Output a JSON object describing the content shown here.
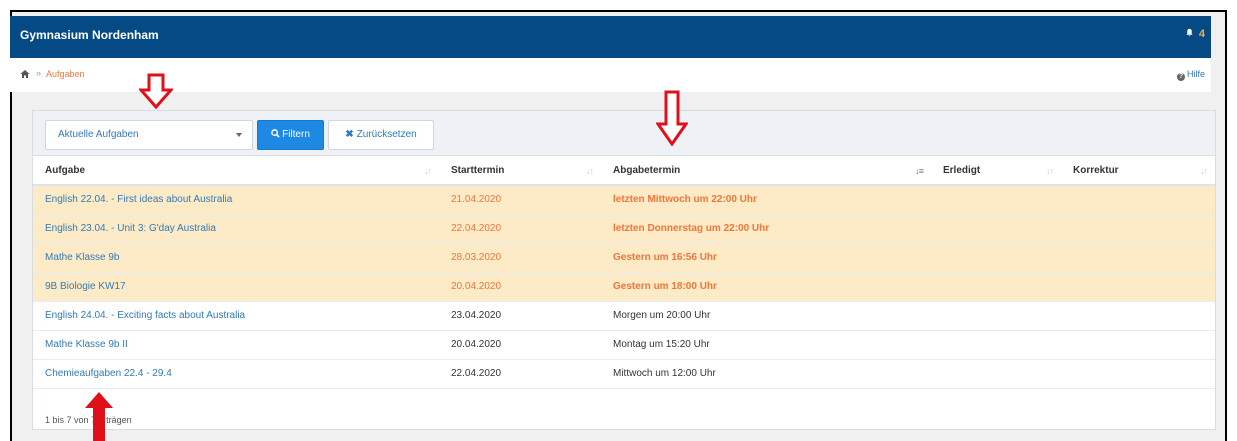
{
  "header": {
    "brand": "Gymnasium Nordenham",
    "notifications_count": "4"
  },
  "breadcrumb": {
    "separator": "»",
    "current": "Aufgaben",
    "help": "Hilfe"
  },
  "filters": {
    "select_value": "Aktuelle Aufgaben",
    "filter_label": "Filtern",
    "reset_label": "Zurücksetzen"
  },
  "table": {
    "columns": [
      "Aufgabe",
      "Starttermin",
      "Abgabetermin",
      "Erledigt",
      "Korrektur"
    ],
    "rows": [
      {
        "task": "English 22.04. - First ideas about Australia",
        "start": "21.04.2020",
        "due": "letzten Mittwoch um 22:00 Uhr",
        "overdue": true
      },
      {
        "task": "English 23.04. - Unit 3: G'day Australia",
        "start": "22.04.2020",
        "due": "letzten Donnerstag um 22:00 Uhr",
        "overdue": true
      },
      {
        "task": "Mathe Klasse 9b",
        "start": "28.03.2020",
        "due": "Gestern um 16:56 Uhr",
        "overdue": true
      },
      {
        "task": "9B Biologie KW17",
        "start": "20.04.2020",
        "due": "Gestern um 18:00 Uhr",
        "overdue": true
      },
      {
        "task": "English 24.04. - Exciting facts about Australia",
        "start": "23.04.2020",
        "due": "Morgen um 20:00 Uhr",
        "overdue": false
      },
      {
        "task": "Mathe Klasse 9b II",
        "start": "20.04.2020",
        "due": "Montag um 15:20 Uhr",
        "overdue": false
      },
      {
        "task": "Chemieaufgaben 22.4 - 29.4",
        "start": "22.04.2020",
        "due": "Mittwoch um 12:00 Uhr",
        "overdue": false
      }
    ]
  },
  "footer": {
    "info_prefix": "1 bis 7 von 7",
    "info_suffix": "trägen"
  },
  "colors": {
    "topbar": "#054a85",
    "overdue_row": "#fcebc6",
    "overdue_text": "#f0763a",
    "link": "#337ab7",
    "filter_button": "#1e88e5",
    "annotation_arrow": "#e0101a"
  }
}
